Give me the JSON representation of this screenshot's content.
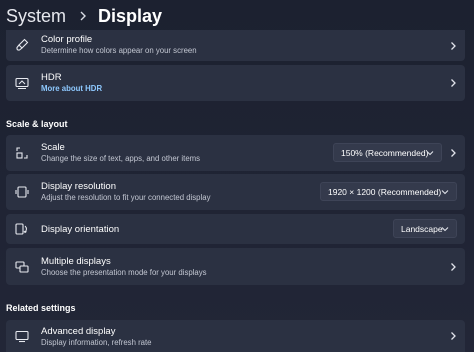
{
  "breadcrumb": {
    "parent": "System",
    "current": "Display"
  },
  "cards_top": {
    "color_profile": {
      "title": "Color profile",
      "subtitle": "Determine how colors appear on your screen"
    },
    "hdr": {
      "title": "HDR",
      "link": "More about HDR"
    }
  },
  "scale_layout": {
    "header": "Scale & layout",
    "scale": {
      "title": "Scale",
      "subtitle": "Change the size of text, apps, and other items",
      "value": "150% (Recommended)"
    },
    "resolution": {
      "title": "Display resolution",
      "subtitle": "Adjust the resolution to fit your connected display",
      "value": "1920 × 1200 (Recommended)"
    },
    "orientation": {
      "title": "Display orientation",
      "value": "Landscape"
    },
    "multiple": {
      "title": "Multiple displays",
      "subtitle": "Choose the presentation mode for your displays"
    }
  },
  "related": {
    "header": "Related settings",
    "advanced": {
      "title": "Advanced display",
      "subtitle": "Display information, refresh rate"
    }
  },
  "icons": {
    "color_profile": "brush-icon",
    "hdr": "hdr-icon",
    "scale": "scale-icon",
    "resolution": "resolution-icon",
    "orientation": "orientation-icon",
    "multiple": "multiple-displays-icon",
    "advanced": "monitor-icon"
  },
  "colors": {
    "background": "#1f2333",
    "card": "#2b3142",
    "link": "#8ec9ff",
    "dropdown": "#343a4c"
  }
}
